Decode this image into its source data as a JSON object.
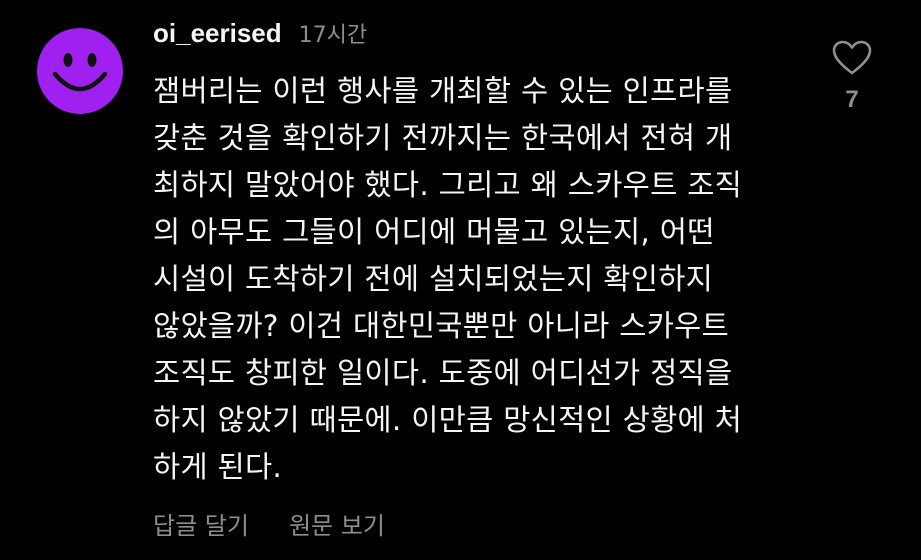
{
  "colors": {
    "background": "#000000",
    "text": "#f5f5f5",
    "muted": "#8e8e8e",
    "avatar": "#a020f0",
    "avatar_face": "#111111"
  },
  "comment": {
    "avatar_icon": "smiley-face",
    "username": "oi_eerised",
    "timestamp": "17시간",
    "text_lines": [
      "잼버리는 이런 행사를 개최할 수 있는 인프라를",
      "갖춘 것을 확인하기 전까지는 한국에서 전혀 개",
      "최하지 말았어야 했다. 그리고 왜 스카우트 조직",
      "의 아무도 그들이 어디에 머물고 있는지, 어떤",
      "시설이 도착하기 전에 설치되었는지 확인하지",
      "않았을까? 이건 대한민국뿐만 아니라 스카우트",
      "조직도 창피한 일이다. 도중에 어디선가 정직을",
      "하지 않았기 때문에. 이만큼 망신적인 상황에 처",
      "하게 된다."
    ],
    "like_icon": "heart-outline",
    "like_count": "7",
    "reply_label": "답글 달기",
    "see_original_label": "원문 보기"
  }
}
